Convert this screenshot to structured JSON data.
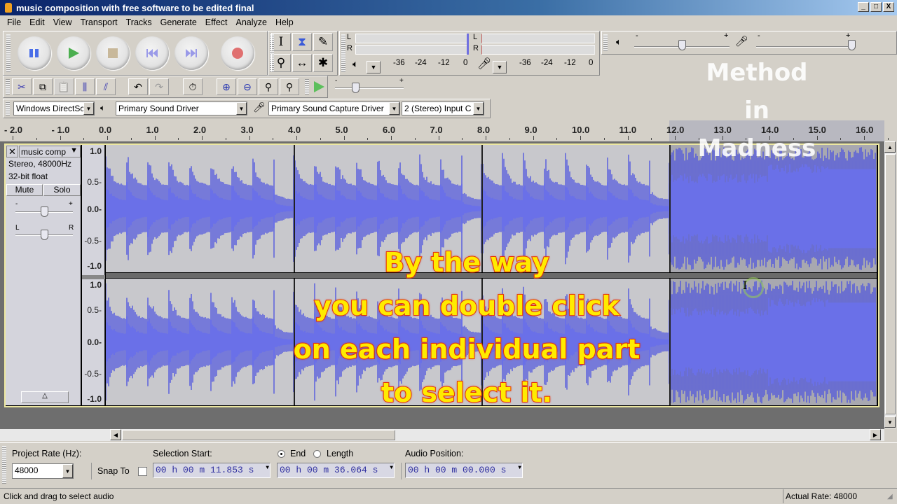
{
  "window": {
    "title": "music composition with free software to be edited final",
    "controls": [
      "_",
      "□",
      "X"
    ]
  },
  "menu": [
    "File",
    "Edit",
    "View",
    "Transport",
    "Tracks",
    "Generate",
    "Effect",
    "Analyze",
    "Help"
  ],
  "transport": {
    "buttons": [
      {
        "name": "pause",
        "icon": "pause-icon",
        "color": "#4a6ee8"
      },
      {
        "name": "play",
        "icon": "play-icon",
        "color": "#4caf50"
      },
      {
        "name": "stop",
        "icon": "stop-icon",
        "color": "#c8b89a"
      },
      {
        "name": "skip-to-start",
        "icon": "skip-start-icon",
        "color": "#9a9ae8"
      },
      {
        "name": "skip-to-end",
        "icon": "skip-end-icon",
        "color": "#9a9ae8"
      },
      {
        "name": "record",
        "icon": "record-icon",
        "color": "#e07070"
      }
    ]
  },
  "tools": [
    {
      "name": "selection-tool",
      "glyph": "I"
    },
    {
      "name": "envelope-tool",
      "glyph": "⧗"
    },
    {
      "name": "draw-tool",
      "glyph": "✎"
    },
    {
      "name": "zoom-tool",
      "glyph": "⚲"
    },
    {
      "name": "timeshift-tool",
      "glyph": "↔"
    },
    {
      "name": "multi-tool",
      "glyph": "✱"
    }
  ],
  "meters": {
    "playback": {
      "channels": [
        "L",
        "R"
      ],
      "scale": [
        "-36",
        "-24",
        "-12",
        "0"
      ]
    },
    "recording": {
      "channels": [
        "L",
        "R"
      ],
      "scale": [
        "-36",
        "-24",
        "-12",
        "0"
      ]
    }
  },
  "edit_toolbar": [
    {
      "name": "cut",
      "glyph": "✂"
    },
    {
      "name": "copy",
      "glyph": "⧉"
    },
    {
      "name": "paste",
      "glyph": "📋"
    },
    {
      "name": "trim",
      "glyph": "⫼"
    },
    {
      "name": "silence",
      "glyph": "⫽"
    },
    {
      "name": "undo",
      "glyph": "↶"
    },
    {
      "name": "redo",
      "glyph": "↷"
    },
    {
      "name": "sync-lock",
      "glyph": "⏱"
    },
    {
      "name": "zoom-in",
      "glyph": "⊕"
    },
    {
      "name": "zoom-out",
      "glyph": "⊖"
    },
    {
      "name": "fit-selection",
      "glyph": "⚲"
    },
    {
      "name": "fit-project",
      "glyph": "⚲"
    }
  ],
  "mixer": {
    "playback_volume": 0.5,
    "recording_volume": 1.0,
    "play_at_speed": 0.3,
    "minus": "-",
    "plus": "+"
  },
  "devices": {
    "host": "Windows DirectSc",
    "playback": "Primary Sound Driver",
    "recording": "Primary Sound Capture Driver",
    "channels": "2 (Stereo) Input C"
  },
  "ruler": {
    "ticks": [
      "- 2.0",
      "- 1.0",
      "0.0",
      "1.0",
      "2.0",
      "3.0",
      "4.0",
      "5.0",
      "6.0",
      "7.0",
      "8.0",
      "9.0",
      "10.0",
      "11.0",
      "12.0",
      "13.0",
      "14.0",
      "15.0",
      "16.0"
    ]
  },
  "track": {
    "name": "music comp",
    "info_line1": "Stereo, 48000Hz",
    "info_line2": "32-bit float",
    "mute": "Mute",
    "solo": "Solo",
    "gain_minus": "-",
    "gain_plus": "+",
    "pan_left": "L",
    "pan_right": "R",
    "gain": 0.5,
    "pan": 0.5,
    "vruler_labels": [
      "1.0",
      "0.5-",
      "0.0-",
      "-0.5-",
      "-1.0"
    ],
    "waveform_color": "#4a50e0",
    "selection_start_sec": 11.853
  },
  "overlays": {
    "caption": [
      "By the way",
      "you can double click",
      "on each individual part",
      "to select it."
    ],
    "watermark": [
      "Method",
      "in",
      "Madness"
    ]
  },
  "selection_toolbar": {
    "project_rate_label": "Project Rate (Hz):",
    "project_rate": "48000",
    "snap_to_label": "Snap To",
    "snap_to_checked": false,
    "selection_start_label": "Selection Start:",
    "end_label": "End",
    "length_label": "Length",
    "end_selected": true,
    "audio_position_label": "Audio Position:",
    "selection_start": "00 h 00 m 11.853 s",
    "selection_end": "00 h 00 m 36.064 s",
    "audio_position": "00 h 00 m 00.000 s"
  },
  "status": {
    "message": "Click and drag to select audio",
    "actual_rate": "Actual Rate: 48000"
  }
}
